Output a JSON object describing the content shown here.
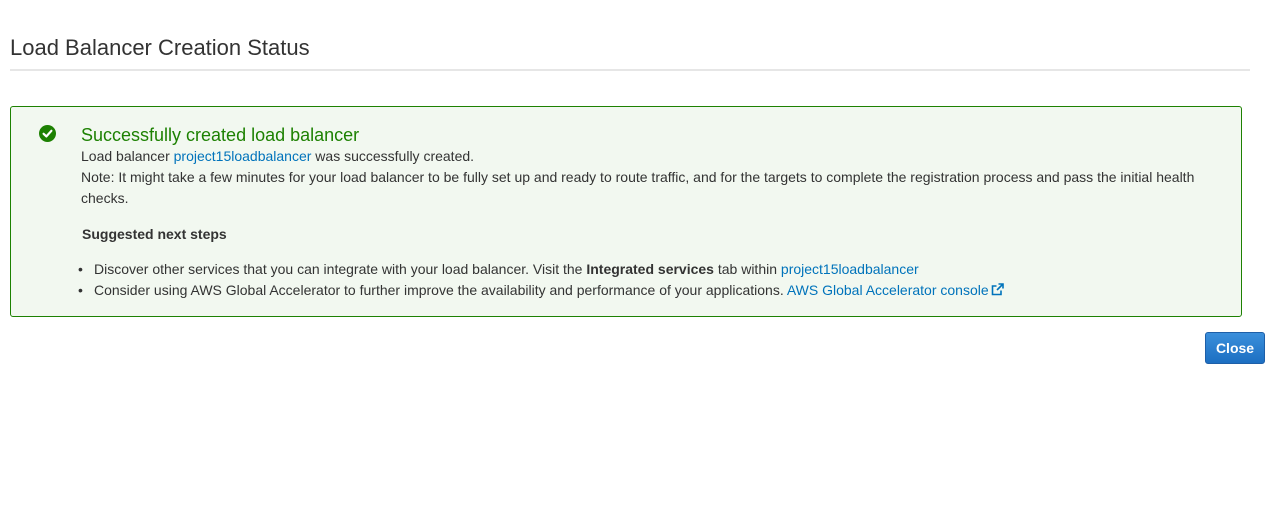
{
  "page": {
    "title": "Load Balancer Creation Status"
  },
  "status_panel": {
    "icon": "check-circle-icon",
    "heading": "Successfully created load balancer",
    "created_prefix": "Load balancer",
    "load_balancer_name": "project15loadbalancer",
    "created_suffix": "was successfully created.",
    "note": "Note: It might take a few minutes for your load balancer to be fully set up and ready to route traffic, and for the targets to complete the registration process and pass the initial health checks.",
    "next_steps_heading": "Suggested next steps",
    "steps": [
      {
        "text_before": "Discover other services that you can integrate with your load balancer. Visit the",
        "bold": "Integrated services",
        "text_after": "tab within",
        "link": "project15loadbalancer"
      },
      {
        "text_before": "Consider using AWS Global Accelerator to further improve the availability and performance of your applications.",
        "link": "AWS Global Accelerator console",
        "link_icon": "external-link-icon"
      }
    ]
  },
  "actions": {
    "close_label": "Close"
  },
  "colors": {
    "success_green": "#1d8102",
    "success_background": "#f2f8f0",
    "link_blue": "#0073bb",
    "button_blue": "#1d6fc2"
  }
}
